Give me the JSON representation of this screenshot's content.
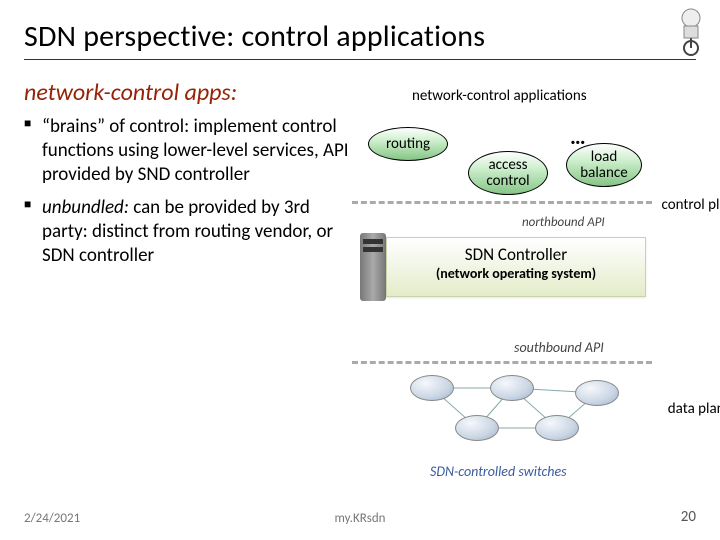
{
  "title": "SDN perspective: control applications",
  "subtitle": "network-control apps:",
  "bullets": [
    {
      "lead": "“brains” of control:",
      "rest": " implement control functions using lower-level services, API provided by SND controller"
    },
    {
      "lead": "unbundled:",
      "rest": " can be provided by 3rd party: distinct from routing vendor, or SDN controller"
    }
  ],
  "diagram": {
    "nca_title": "network-control applications",
    "routing": "routing",
    "access": "access control",
    "load": "load balance",
    "dots": "…",
    "control_plane": "control plane",
    "nb": "northbound API",
    "ctrl_name": "SDN Controller",
    "ctrl_nos": "(network operating system)",
    "sb": "southbound API",
    "data_plane": "data plane",
    "switches": "SDN-controlled switches"
  },
  "footer": {
    "date": "2/24/2021",
    "center": "my.KRsdn",
    "page": "20"
  }
}
